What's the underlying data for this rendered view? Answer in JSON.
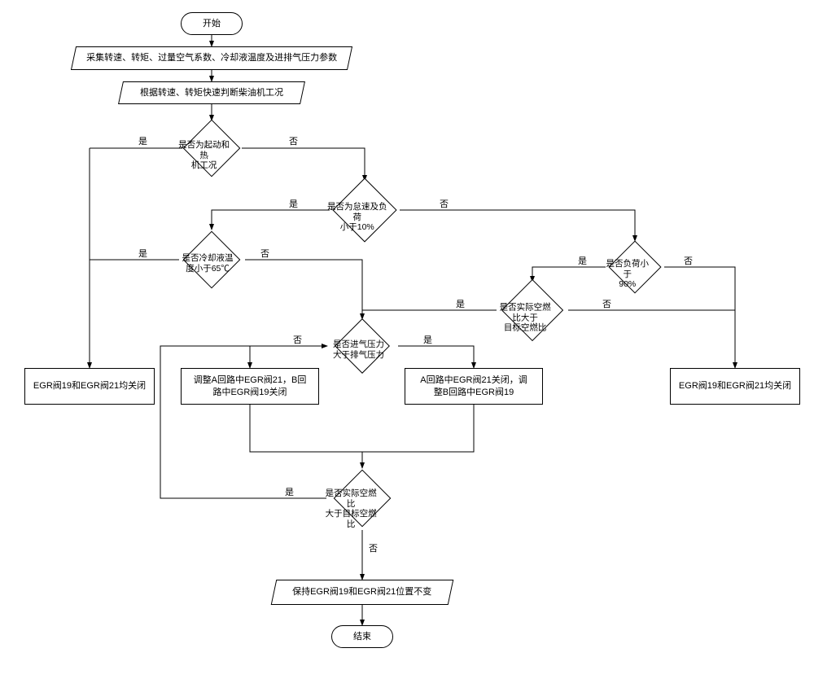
{
  "terminator_start": "开始",
  "terminator_end": "结束",
  "io_collect": "采集转速、转矩、过量空气系数、冷却液温度及进排气压力参数",
  "io_judge": "根据转速、转矩快速判断柴油机工况",
  "io_keep": "保持EGR阀19和EGR阀21位置不变",
  "dec_start_warmup": "是否为起动和热\n机工况",
  "dec_idle_load10": "是否为怠速及负荷\n小于10%",
  "dec_coolant65": "是否冷却液温\n度小于65℃",
  "dec_load90": "是否负荷小于\n90%",
  "dec_afr_vs_target_1": "是否实际空燃比大于\n目标空燃比",
  "dec_intake_gt_exhaust": "是否进气压力\n大于排气压力",
  "dec_afr_vs_target_2": "是否实际空燃比\n大于目标空燃比",
  "proc_both_closed_left": "EGR阀19和EGR阀21均关闭",
  "proc_both_closed_right": "EGR阀19和EGR阀21均关闭",
  "proc_adjust_A": "调整A回路中EGR阀21，B回\n路中EGR阀19关闭",
  "proc_adjust_B": "A回路中EGR阀21关闭，调\n整B回路中EGR阀19",
  "yes": "是",
  "no": "否"
}
